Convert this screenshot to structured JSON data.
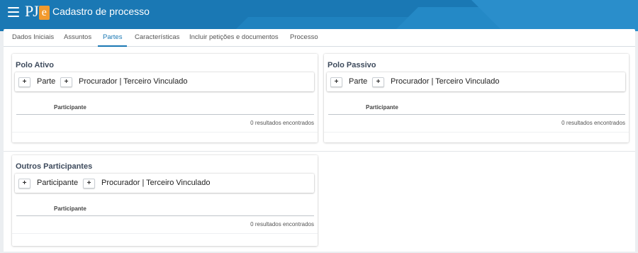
{
  "header": {
    "logo_text": "PJ",
    "logo_e": "e",
    "title": "Cadastro de processo",
    "menu_icon": "hamburger-menu-icon"
  },
  "tabs": [
    {
      "label": "Dados Iniciais",
      "active": false
    },
    {
      "label": "Assuntos",
      "active": false
    },
    {
      "label": "Partes",
      "active": true
    },
    {
      "label": "Características",
      "active": false
    },
    {
      "label": "Incluir petições e documentos",
      "active": false
    },
    {
      "label": "Processo",
      "active": false
    }
  ],
  "panels": {
    "polo_ativo": {
      "title": "Polo Ativo",
      "add_symbol_1": "+",
      "button_1": "Parte",
      "add_symbol_2": "+",
      "button_2": "Procurador | Terceiro Vinculado",
      "column_header": "Participante",
      "results": "0 resultados encontrados"
    },
    "polo_passivo": {
      "title": "Polo Passivo",
      "add_symbol_1": "+",
      "button_1": "Parte",
      "add_symbol_2": "+",
      "button_2": "Procurador | Terceiro Vinculado",
      "column_header": "Participante",
      "results": "0 resultados encontrados"
    },
    "outros": {
      "title": "Outros Participantes",
      "add_symbol_1": "+",
      "button_1": "Participante",
      "add_symbol_2": "+",
      "button_2": "Procurador | Terceiro Vinculado",
      "column_header": "Participante",
      "results": "0 resultados encontrados"
    }
  },
  "colors": {
    "header_bg": "#1a78b4",
    "logo_accent": "#f29a2e",
    "active_tab": "#1a78b4"
  }
}
